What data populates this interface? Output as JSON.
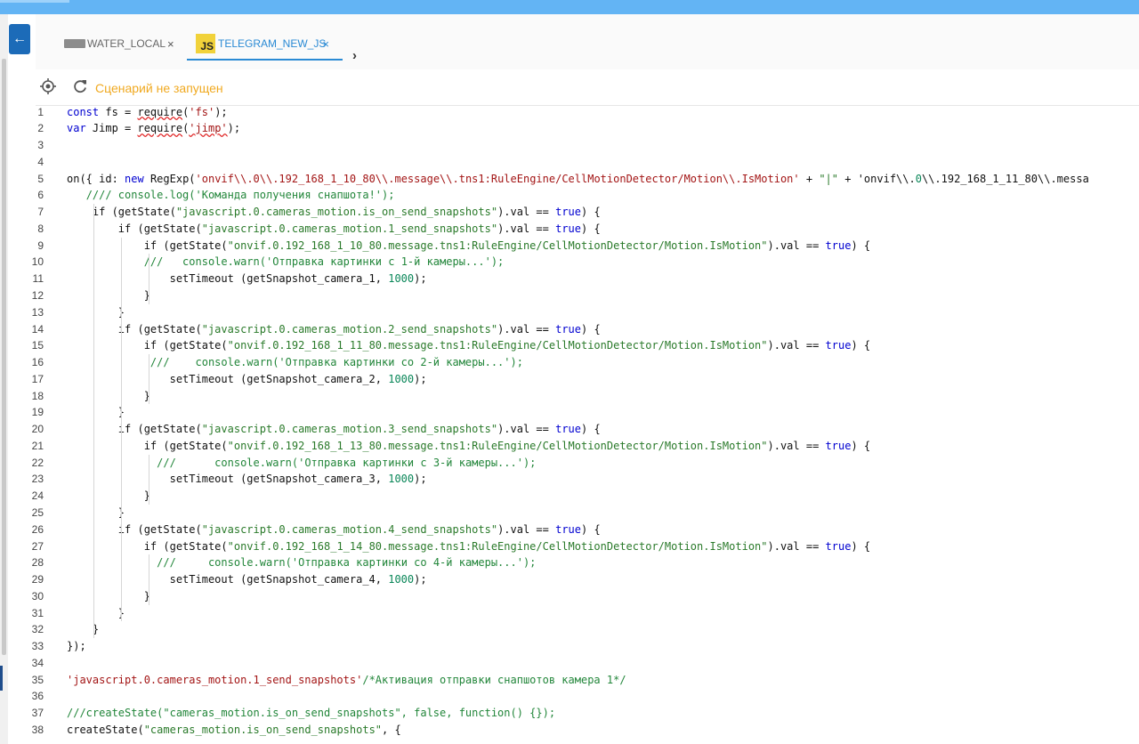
{
  "header": {
    "back_icon": "arrow-left-icon"
  },
  "tabs": [
    {
      "label": "WATER_LOCAL",
      "icon": "blockly-icon",
      "close": "×",
      "active": false
    },
    {
      "label": "TELEGRAM_NEW_JS",
      "icon": "JS",
      "close": "×",
      "active": true
    }
  ],
  "toolbar": {
    "status": "Сценарий не запущен"
  },
  "colors": {
    "accent": "#2a8ad4",
    "status": "#f0a920",
    "topbar": "#63b4f4"
  },
  "code": [
    "const fs = require('fs');",
    "var Jimp = require('jimp');",
    "",
    "",
    "on({ id: new RegExp('onvif\\\\.0\\\\.192_168_1_10_80\\\\.message\\\\.tns1:RuleEngine/CellMotionDetector/Motion\\\\.IsMotion' + \"|\" + 'onvif\\\\.0\\\\.192_168_1_11_80\\\\.messa",
    "   //// console.log('Команда получения снапшота!');",
    "    if (getState(\"javascript.0.cameras_motion.is_on_send_snapshots\").val == true) {",
    "        if (getState(\"javascript.0.cameras_motion.1_send_snapshots\").val == true) {",
    "            if (getState(\"onvif.0.192_168_1_10_80.message.tns1:RuleEngine/CellMotionDetector/Motion.IsMotion\").val == true) {",
    "            ///   console.warn('Отправка картинки с 1-й камеры...');",
    "                setTimeout (getSnapshot_camera_1, 1000);",
    "            }",
    "        }",
    "        if (getState(\"javascript.0.cameras_motion.2_send_snapshots\").val == true) {",
    "            if (getState(\"onvif.0.192_168_1_11_80.message.tns1:RuleEngine/CellMotionDetector/Motion.IsMotion\").val == true) {",
    "             ///    console.warn('Отправка картинки со 2-й камеры...');",
    "                setTimeout (getSnapshot_camera_2, 1000);",
    "            }",
    "        }",
    "        if (getState(\"javascript.0.cameras_motion.3_send_snapshots\").val == true) {",
    "            if (getState(\"onvif.0.192_168_1_13_80.message.tns1:RuleEngine/CellMotionDetector/Motion.IsMotion\").val == true) {",
    "              ///      console.warn('Отправка картинки с 3-й камеры...');",
    "                setTimeout (getSnapshot_camera_3, 1000);",
    "            }",
    "        }",
    "        if (getState(\"javascript.0.cameras_motion.4_send_snapshots\").val == true) {",
    "            if (getState(\"onvif.0.192_168_1_14_80.message.tns1:RuleEngine/CellMotionDetector/Motion.IsMotion\").val == true) {",
    "              ///     console.warn('Отправка картинки со 4-й камеры...');",
    "                setTimeout (getSnapshot_camera_4, 1000);",
    "            }",
    "        }",
    "    }",
    "});",
    "",
    "'javascript.0.cameras_motion.1_send_snapshots'/*Активация отправки снапшотов камера 1*/",
    "",
    "///createState(\"cameras_motion.is_on_send_snapshots\", false, function() {});",
    "createState(\"cameras_motion.is_on_send_snapshots\", {"
  ]
}
